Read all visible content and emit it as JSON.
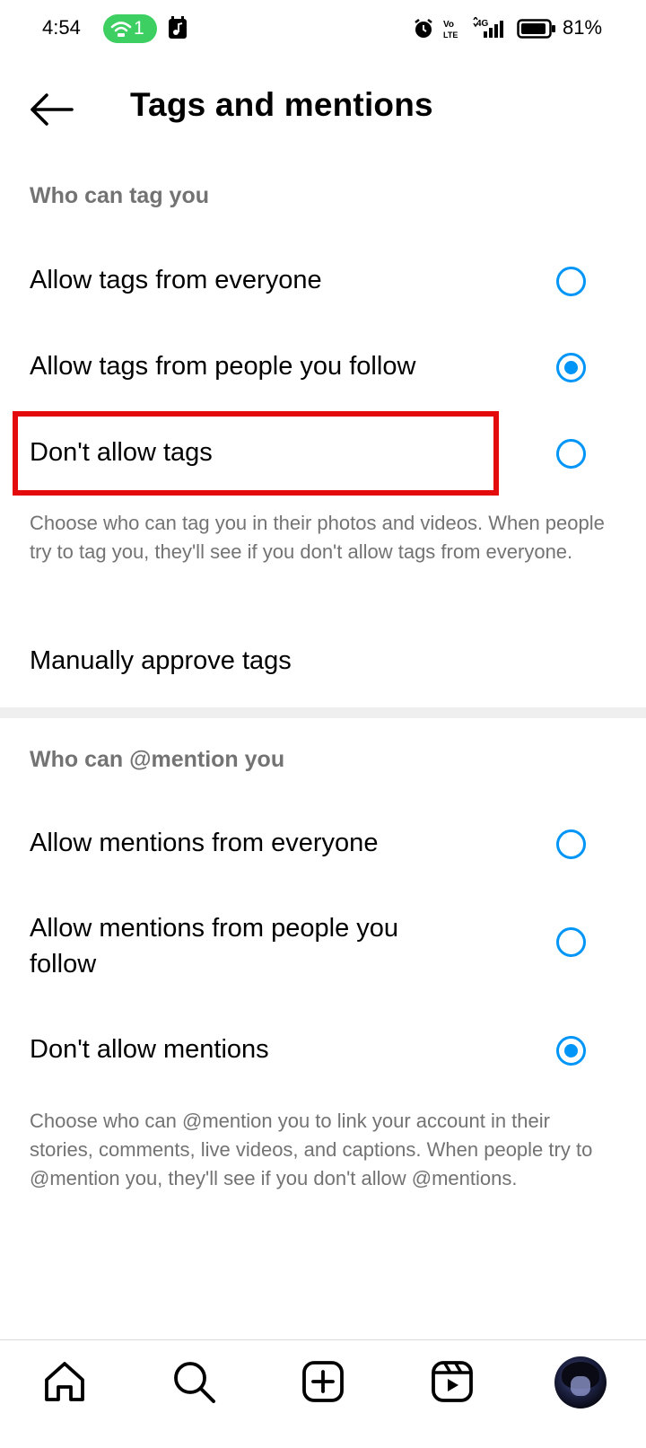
{
  "status_bar": {
    "time": "4:54",
    "hotspot_count": "1",
    "battery": "81%",
    "icons": [
      "wifi-hotspot-icon",
      "music-icon",
      "alarm-icon",
      "volte-icon",
      "4g-signal-icon",
      "battery-icon"
    ]
  },
  "header": {
    "title": "Tags and mentions",
    "back_icon": "arrow-left-icon"
  },
  "tags_section": {
    "heading": "Who can tag you",
    "options": [
      {
        "label": "Allow tags from everyone",
        "selected": false
      },
      {
        "label": "Allow tags from people you follow",
        "selected": true
      },
      {
        "label": "Don't allow tags",
        "selected": false
      }
    ],
    "description": "Choose who can tag you in their photos and videos. When people try to tag you, they'll see if you don't allow tags from everyone.",
    "manual_approve": "Manually approve tags"
  },
  "mentions_section": {
    "heading": "Who can @mention you",
    "options": [
      {
        "label": "Allow mentions from everyone",
        "selected": false
      },
      {
        "label": "Allow mentions from people you follow",
        "selected": false
      },
      {
        "label": "Don't allow mentions",
        "selected": true
      }
    ],
    "description": "Choose who can @mention you to link your account in their stories, comments, live videos, and captions. When people try to @mention you, they'll see if you don't allow @mentions."
  },
  "bottom_nav": {
    "items": [
      "home-icon",
      "search-icon",
      "create-post-icon",
      "reels-icon",
      "profile-avatar"
    ]
  },
  "colors": {
    "accent": "#0095f6",
    "highlight": "#e30b0b",
    "secondary_text": "#737373",
    "hotspot": "#3ecf62"
  }
}
